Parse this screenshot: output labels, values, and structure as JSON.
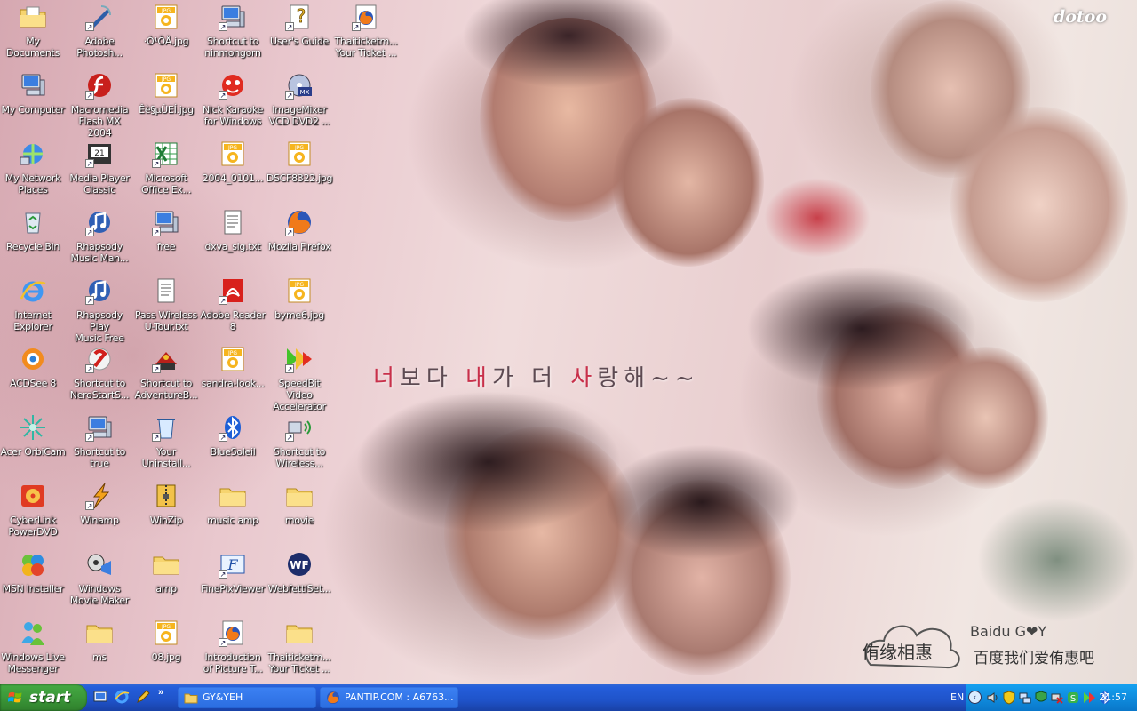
{
  "wallpaper": {
    "logo": "dotoo",
    "caption_parts": [
      "너",
      "보다 ",
      "내",
      "가 더 ",
      "사",
      "랑해~~"
    ],
    "baidu_cn_left": "侑缘相惠",
    "baidu_en": "Baidu G❤Y",
    "baidu_cn_right": "百度我们爱侑惠吧"
  },
  "icons": [
    {
      "label": "My Documents",
      "icon": "folder-docs"
    },
    {
      "label": "My Computer",
      "icon": "computer"
    },
    {
      "label": "My Network\nPlaces",
      "icon": "network"
    },
    {
      "label": "Recycle Bin",
      "icon": "recycle"
    },
    {
      "label": "Internet\nExplorer",
      "icon": "ie"
    },
    {
      "label": "ACDSee 8",
      "icon": "acdsee"
    },
    {
      "label": "Acer OrbiCam",
      "icon": "orbicam"
    },
    {
      "label": "CyberLink\nPowerDVD",
      "icon": "powerdvd"
    },
    {
      "label": "MSN Installer",
      "icon": "msn"
    },
    {
      "label": "Windows Live\nMessenger",
      "icon": "messenger"
    },
    {
      "label": "Adobe\nPhotosh...",
      "icon": "photoshop",
      "shortcut": true
    },
    {
      "label": "Macromedia\nFlash MX 2004",
      "icon": "flash",
      "shortcut": true
    },
    {
      "label": "Media Player\nClassic",
      "icon": "mpc",
      "shortcut": true
    },
    {
      "label": "Rhapsody\nMusic Man...",
      "icon": "rhapsody",
      "shortcut": true
    },
    {
      "label": "Rhapsody Play\nMusic Free",
      "icon": "rhapsody-play",
      "shortcut": true
    },
    {
      "label": "Shortcut to\nNeroStartS...",
      "icon": "nero",
      "shortcut": true
    },
    {
      "label": "Shortcut to\ntrue",
      "icon": "computer-small",
      "shortcut": true
    },
    {
      "label": "Winamp",
      "icon": "winamp",
      "shortcut": true
    },
    {
      "label": "Windows\nMovie Maker",
      "icon": "moviemaker"
    },
    {
      "label": "ms",
      "icon": "folder"
    },
    {
      "label": "·Ó¹ÕÅ.jpg",
      "icon": "jpg"
    },
    {
      "label": "Êè§µÙEÍ.jpg",
      "icon": "jpg"
    },
    {
      "label": "Microsoft\nOffice Ex...",
      "icon": "excel",
      "shortcut": true
    },
    {
      "label": "free",
      "icon": "computer-small",
      "shortcut": true
    },
    {
      "label": "Pass Wireless\nU-Tour.txt",
      "icon": "txt"
    },
    {
      "label": "Shortcut to\nAdventureB...",
      "icon": "adventure",
      "shortcut": true
    },
    {
      "label": "Your\nUninstall...",
      "icon": "uninstall",
      "shortcut": true
    },
    {
      "label": "WinZip",
      "icon": "winzip"
    },
    {
      "label": "amp",
      "icon": "folder"
    },
    {
      "label": "08.jpg",
      "icon": "jpg"
    },
    {
      "label": "Shortcut to\nninmongorn",
      "icon": "computer-small",
      "shortcut": true
    },
    {
      "label": "Nick Karaoke\nfor Windows",
      "icon": "karaoke",
      "shortcut": true
    },
    {
      "label": "2004_0101...",
      "icon": "jpg"
    },
    {
      "label": "dxva_sig.txt",
      "icon": "txt"
    },
    {
      "label": "Adobe Reader\n8",
      "icon": "reader",
      "shortcut": true
    },
    {
      "label": "sandra-look...",
      "icon": "jpg"
    },
    {
      "label": "BlueSoleil",
      "icon": "bluetooth",
      "shortcut": true
    },
    {
      "label": "music amp",
      "icon": "folder"
    },
    {
      "label": "FinePixViewer",
      "icon": "finepix",
      "shortcut": true
    },
    {
      "label": "Introduction\nof Picture T...",
      "icon": "firefox-doc",
      "shortcut": true
    },
    {
      "label": "User's Guide",
      "icon": "help",
      "shortcut": true
    },
    {
      "label": "ImageMixer\nVCD DVD2 ...",
      "icon": "imagemixer",
      "shortcut": true
    },
    {
      "label": "DSCF8322.jpg",
      "icon": "jpg"
    },
    {
      "label": "Mozila Firefox",
      "icon": "firefox",
      "shortcut": true
    },
    {
      "label": "byme6.jpg",
      "icon": "jpg"
    },
    {
      "label": "SpeedBit Video\nAccelerator",
      "icon": "speedbit",
      "shortcut": true
    },
    {
      "label": "Shortcut to\nWireless...",
      "icon": "wireless",
      "shortcut": true
    },
    {
      "label": "movie",
      "icon": "folder"
    },
    {
      "label": "WebfettiSet...",
      "icon": "webfetti"
    },
    {
      "label": "Thaiticketm...\nYour Ticket ...",
      "icon": "folder"
    },
    {
      "label": "Thaiticketm...\nYour Ticket ...",
      "icon": "firefox-doc",
      "shortcut": true
    }
  ],
  "taskbar": {
    "start_label": "start",
    "tasks": [
      {
        "title": "GY&YEH",
        "icon": "folder-icon"
      },
      {
        "title": "PANTIP.COM : A6763...",
        "icon": "firefox-icon"
      }
    ],
    "language": "EN",
    "clock": "21:57"
  }
}
